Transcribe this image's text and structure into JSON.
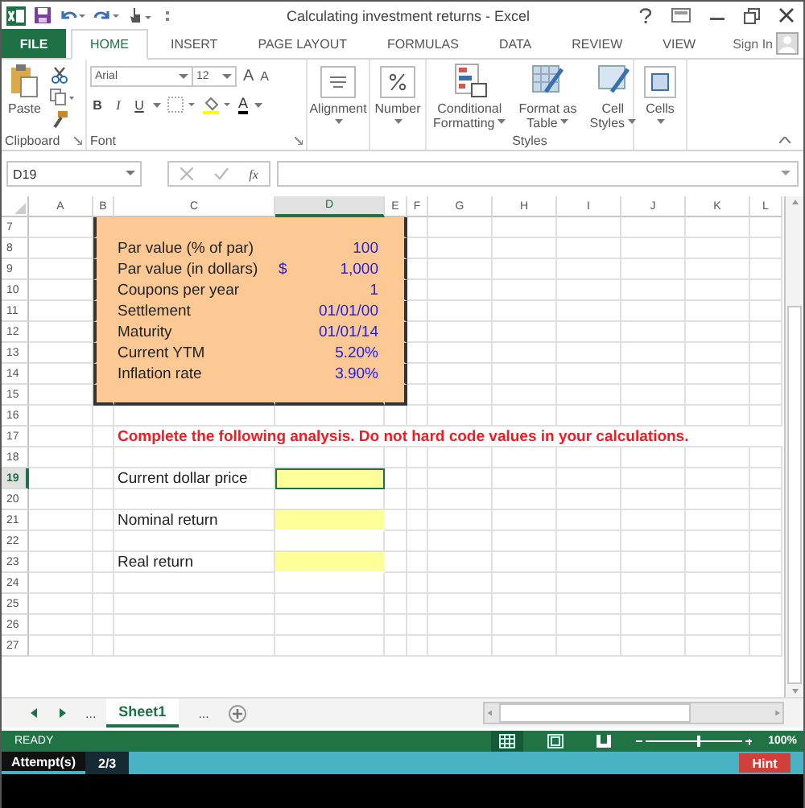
{
  "window": {
    "title": "Calculating investment returns - Excel"
  },
  "ribbon_tabs": [
    {
      "label": "FILE",
      "kind": "file",
      "selected": false
    },
    {
      "label": "HOME",
      "kind": "tab",
      "selected": true
    },
    {
      "label": "INSERT",
      "kind": "tab",
      "selected": false
    },
    {
      "label": "PAGE LAYOUT",
      "kind": "tab",
      "selected": false
    },
    {
      "label": "FORMULAS",
      "kind": "tab",
      "selected": false
    },
    {
      "label": "DATA",
      "kind": "tab",
      "selected": false
    },
    {
      "label": "REVIEW",
      "kind": "tab",
      "selected": false
    },
    {
      "label": "VIEW",
      "kind": "tab",
      "selected": false
    }
  ],
  "sign_in": "Sign In",
  "ribbon": {
    "paste": "Paste",
    "font_name": "Arial",
    "font_size": "12",
    "grow_font": "A",
    "shrink_font": "A",
    "bold": "B",
    "italic": "I",
    "underline": "U",
    "font_color": "A",
    "alignment": "Alignment",
    "number": "Number",
    "conditional_formatting": [
      "Conditional",
      "Formatting"
    ],
    "format_as_table": [
      "Format as",
      "Table"
    ],
    "cell_styles": [
      "Cell",
      "Styles"
    ],
    "cells": "Cells",
    "clipboard_group": "Clipboard",
    "font_group": "Font",
    "styles_group": "Styles"
  },
  "formula_bar": {
    "name_box": "D19",
    "insert_function": "fx"
  },
  "columns": [
    {
      "label": "A",
      "selected": false
    },
    {
      "label": "B",
      "selected": false
    },
    {
      "label": "C",
      "selected": false
    },
    {
      "label": "D",
      "selected": true
    },
    {
      "label": "E",
      "selected": false
    },
    {
      "label": "F",
      "selected": false
    },
    {
      "label": "G",
      "selected": false
    },
    {
      "label": "H",
      "selected": false
    },
    {
      "label": "I",
      "selected": false
    },
    {
      "label": "J",
      "selected": false
    },
    {
      "label": "K",
      "selected": false
    },
    {
      "label": "L",
      "selected": false
    }
  ],
  "rows": [
    {
      "number": "7",
      "kind": "blank",
      "in_box": true,
      "selected": false
    },
    {
      "number": "8",
      "kind": "input",
      "in_box": true,
      "selected": false,
      "label": "Par value (% of par)",
      "value": "100"
    },
    {
      "number": "9",
      "kind": "input",
      "in_box": true,
      "selected": false,
      "label": "Par value (in dollars)",
      "currency": "$",
      "value": "1,000"
    },
    {
      "number": "10",
      "kind": "input",
      "in_box": true,
      "selected": false,
      "label": "Coupons per year",
      "value": "1"
    },
    {
      "number": "11",
      "kind": "input",
      "in_box": true,
      "selected": false,
      "label": "Settlement",
      "value": "01/01/00"
    },
    {
      "number": "12",
      "kind": "input",
      "in_box": true,
      "selected": false,
      "label": "Maturity",
      "value": "01/01/14"
    },
    {
      "number": "13",
      "kind": "input",
      "in_box": true,
      "selected": false,
      "label": "Current YTM",
      "value": "5.20%"
    },
    {
      "number": "14",
      "kind": "input",
      "in_box": true,
      "selected": false,
      "label": "Inflation rate",
      "value": "3.90%"
    },
    {
      "number": "15",
      "kind": "blank",
      "in_box": true,
      "selected": false
    },
    {
      "number": "16",
      "kind": "blank",
      "in_box": false,
      "selected": false
    },
    {
      "number": "17",
      "kind": "prompt",
      "in_box": false,
      "selected": false,
      "label": "Complete the following analysis. Do not hard code values in your calculations."
    },
    {
      "number": "18",
      "kind": "blank",
      "in_box": false,
      "selected": false
    },
    {
      "number": "19",
      "kind": "answer",
      "in_box": false,
      "selected": true,
      "label": "Current dollar price"
    },
    {
      "number": "20",
      "kind": "blank",
      "in_box": false,
      "selected": false
    },
    {
      "number": "21",
      "kind": "answer",
      "in_box": false,
      "selected": false,
      "label": "Nominal return"
    },
    {
      "number": "22",
      "kind": "blank",
      "in_box": false,
      "selected": false
    },
    {
      "number": "23",
      "kind": "answer",
      "in_box": false,
      "selected": false,
      "label": "Real return"
    },
    {
      "number": "24",
      "kind": "blank",
      "in_box": false,
      "selected": false
    },
    {
      "number": "25",
      "kind": "blank",
      "in_box": false,
      "selected": false
    },
    {
      "number": "26",
      "kind": "blank",
      "in_box": false,
      "selected": false
    },
    {
      "number": "27",
      "kind": "blank",
      "in_box": false,
      "selected": false
    }
  ],
  "sheet_tabs": {
    "more_left": "...",
    "tabs": [
      {
        "label": "Sheet1",
        "selected": true
      }
    ],
    "more_right": "..."
  },
  "status_bar": {
    "mode": "READY",
    "views": [
      {
        "kind": "normal",
        "selected": true
      },
      {
        "kind": "page-layout",
        "selected": false
      },
      {
        "kind": "page-break",
        "selected": false
      }
    ],
    "zoom_slider": {
      "level": 0.55
    },
    "zoom": "100%"
  },
  "attempts": {
    "label": "Attempt(s)",
    "count": "2/3",
    "hint": "Hint"
  }
}
